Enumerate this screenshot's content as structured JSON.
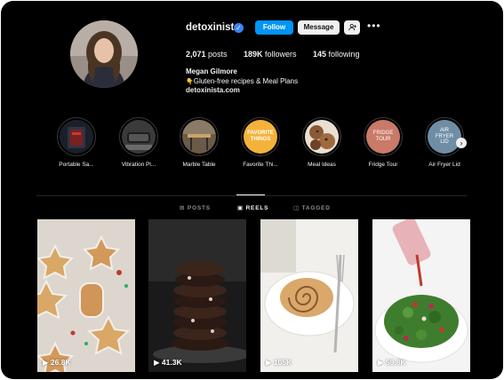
{
  "profile": {
    "username": "detoxinista",
    "verified_icon": "verified-badge-icon",
    "follow_label": "Follow",
    "message_label": "Message",
    "add_user_icon": "add-user-icon",
    "more_icon": "more-icon",
    "posts_count": "2,071",
    "posts_label": "posts",
    "followers_count": "189K",
    "followers_label": "followers",
    "following_count": "145",
    "following_label": "following",
    "full_name": "Megan Gilmore",
    "bio": "Gluten-free recipes & Meal Plans",
    "bio_icon": "👇",
    "website": "detoxinista.com",
    "accent": "#0095f6"
  },
  "highlights": [
    {
      "label": "Portable Sa...",
      "circle_text": ""
    },
    {
      "label": "Vibration Pl...",
      "circle_text": ""
    },
    {
      "label": "Marble Table",
      "circle_text": ""
    },
    {
      "label": "Favorite Thi...",
      "circle_text": "FAVORITE THINGS"
    },
    {
      "label": "Meal Ideas",
      "circle_text": ""
    },
    {
      "label": "Fridge Tour",
      "circle_text": "FRIDGE TOUR"
    },
    {
      "label": "Air Fryer Lid",
      "circle_text": "AIR FRYER LID"
    }
  ],
  "highlights_next_icon": "chevron-right-icon",
  "tabs": [
    {
      "label": "POSTS",
      "icon": "grid-icon",
      "active": false
    },
    {
      "label": "REELS",
      "icon": "reels-icon",
      "active": true
    },
    {
      "label": "TAGGED",
      "icon": "tagged-icon",
      "active": false
    }
  ],
  "reels": [
    {
      "views": "26.8K",
      "icon": "play-icon"
    },
    {
      "views": "41.3K",
      "icon": "play-icon"
    },
    {
      "views": "105K",
      "icon": "play-icon"
    },
    {
      "views": "59.8K",
      "icon": "play-icon"
    }
  ]
}
